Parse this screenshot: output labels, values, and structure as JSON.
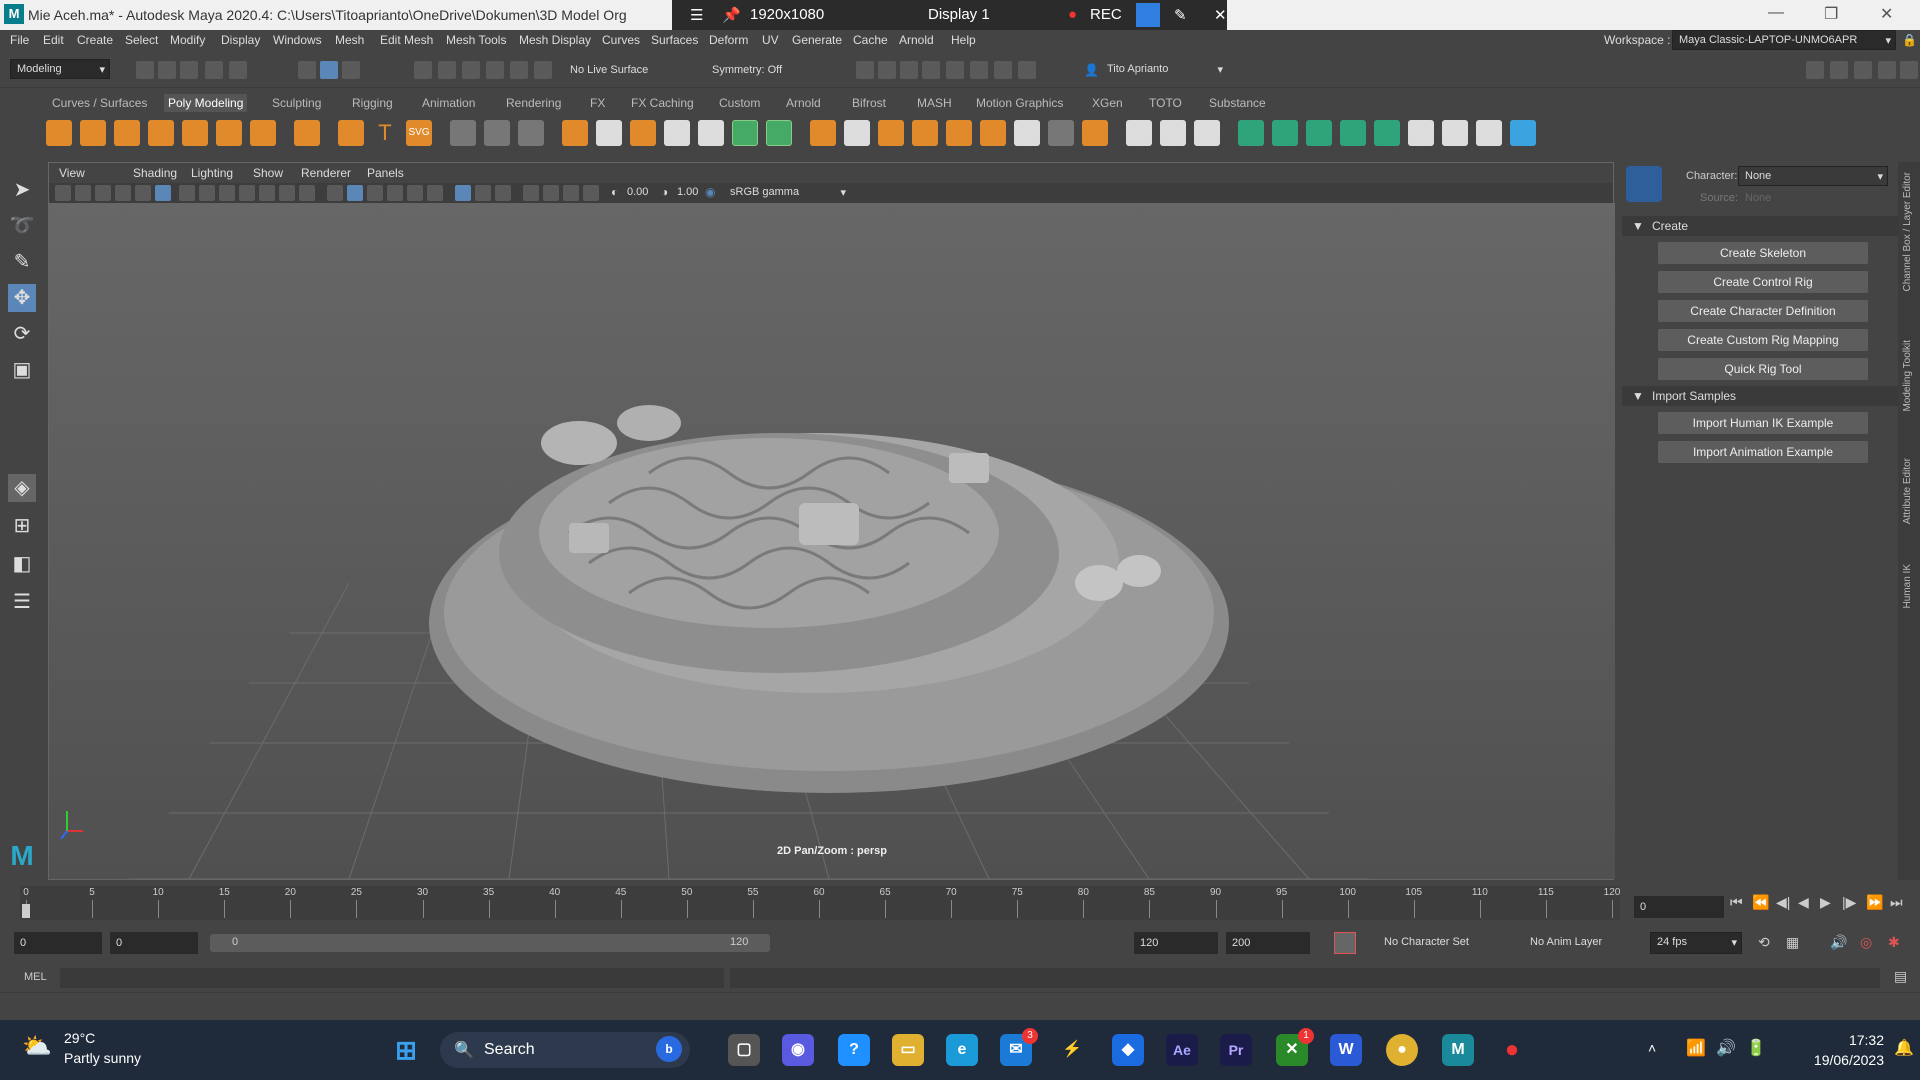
{
  "titlebar": {
    "title": "Mie Aceh.ma* - Autodesk Maya 2020.4: C:\\Users\\Titoaprianto\\OneDrive\\Dokumen\\3D Model Org",
    "app_icon": "M",
    "resolution": "1920x1080",
    "display": "Display 1",
    "rec_label": "REC"
  },
  "menubar": [
    "File",
    "Edit",
    "Create",
    "Select",
    "Modify",
    "Display",
    "Windows",
    "Mesh",
    "Edit Mesh",
    "Mesh Tools",
    "Mesh Display",
    "Curves",
    "Surfaces",
    "Deform",
    "UV",
    "Generate",
    "Cache",
    "Arnold",
    "Help"
  ],
  "workspace": {
    "label": "Workspace :",
    "value": "Maya Classic-LAPTOP-UNMO6APR"
  },
  "statusline": {
    "mode": "Modeling",
    "live_surface": "No Live Surface",
    "symmetry": "Symmetry: Off",
    "user": "Tito Aprianto"
  },
  "shelf_tabs": [
    {
      "label": "Curves / Surfaces",
      "active": false
    },
    {
      "label": "Poly Modeling",
      "active": true
    },
    {
      "label": "Sculpting",
      "active": false
    },
    {
      "label": "Rigging",
      "active": false
    },
    {
      "label": "Animation",
      "active": false
    },
    {
      "label": "Rendering",
      "active": false
    },
    {
      "label": "FX",
      "active": false
    },
    {
      "label": "FX Caching",
      "active": false
    },
    {
      "label": "Custom",
      "active": false
    },
    {
      "label": "Arnold",
      "active": false
    },
    {
      "label": "Bifrost",
      "active": false
    },
    {
      "label": "MASH",
      "active": false
    },
    {
      "label": "Motion Graphics",
      "active": false
    },
    {
      "label": "XGen",
      "active": false
    },
    {
      "label": "TOTO",
      "active": false
    },
    {
      "label": "Substance",
      "active": false
    }
  ],
  "viewport": {
    "menu": [
      "View",
      "Shading",
      "Lighting",
      "Show",
      "Renderer",
      "Panels"
    ],
    "field1": "0.00",
    "field2": "1.00",
    "color_space": "sRGB gamma",
    "camera_label": "2D Pan/Zoom : persp"
  },
  "humanik": {
    "character_label": "Character:",
    "character_value": "None",
    "source_label": "Source:",
    "source_value": "None",
    "create_header": "Create",
    "create_buttons": [
      "Create Skeleton",
      "Create Control Rig",
      "Create Character Definition",
      "Create Custom Rig Mapping",
      "Quick Rig Tool"
    ],
    "import_header": "Import Samples",
    "import_buttons": [
      "Import Human IK Example",
      "Import Animation Example"
    ]
  },
  "side_tabs": [
    "Channel Box / Layer Editor",
    "Modeling Toolkit",
    "Attribute Editor",
    "Human IK"
  ],
  "timeline": {
    "ticks": [
      "0",
      "5",
      "10",
      "15",
      "20",
      "25",
      "30",
      "35",
      "40",
      "45",
      "50",
      "55",
      "60",
      "65",
      "70",
      "75",
      "80",
      "85",
      "90",
      "95",
      "100",
      "105",
      "110",
      "115",
      "120"
    ],
    "current_frame": "0"
  },
  "range": {
    "start": "0",
    "anim_start": "0",
    "slider_start": "0",
    "slider_end": "120",
    "end": "120",
    "anim_end": "200",
    "character_set": "No Character Set",
    "anim_layer": "No Anim Layer",
    "fps": "24 fps"
  },
  "cmdline": {
    "label": "MEL"
  },
  "taskbar": {
    "weather_temp": "29°C",
    "weather_desc": "Partly sunny",
    "search": "Search",
    "time": "17:32",
    "date": "19/06/2023",
    "mail_badge": "3",
    "xbox_badge": "1"
  }
}
